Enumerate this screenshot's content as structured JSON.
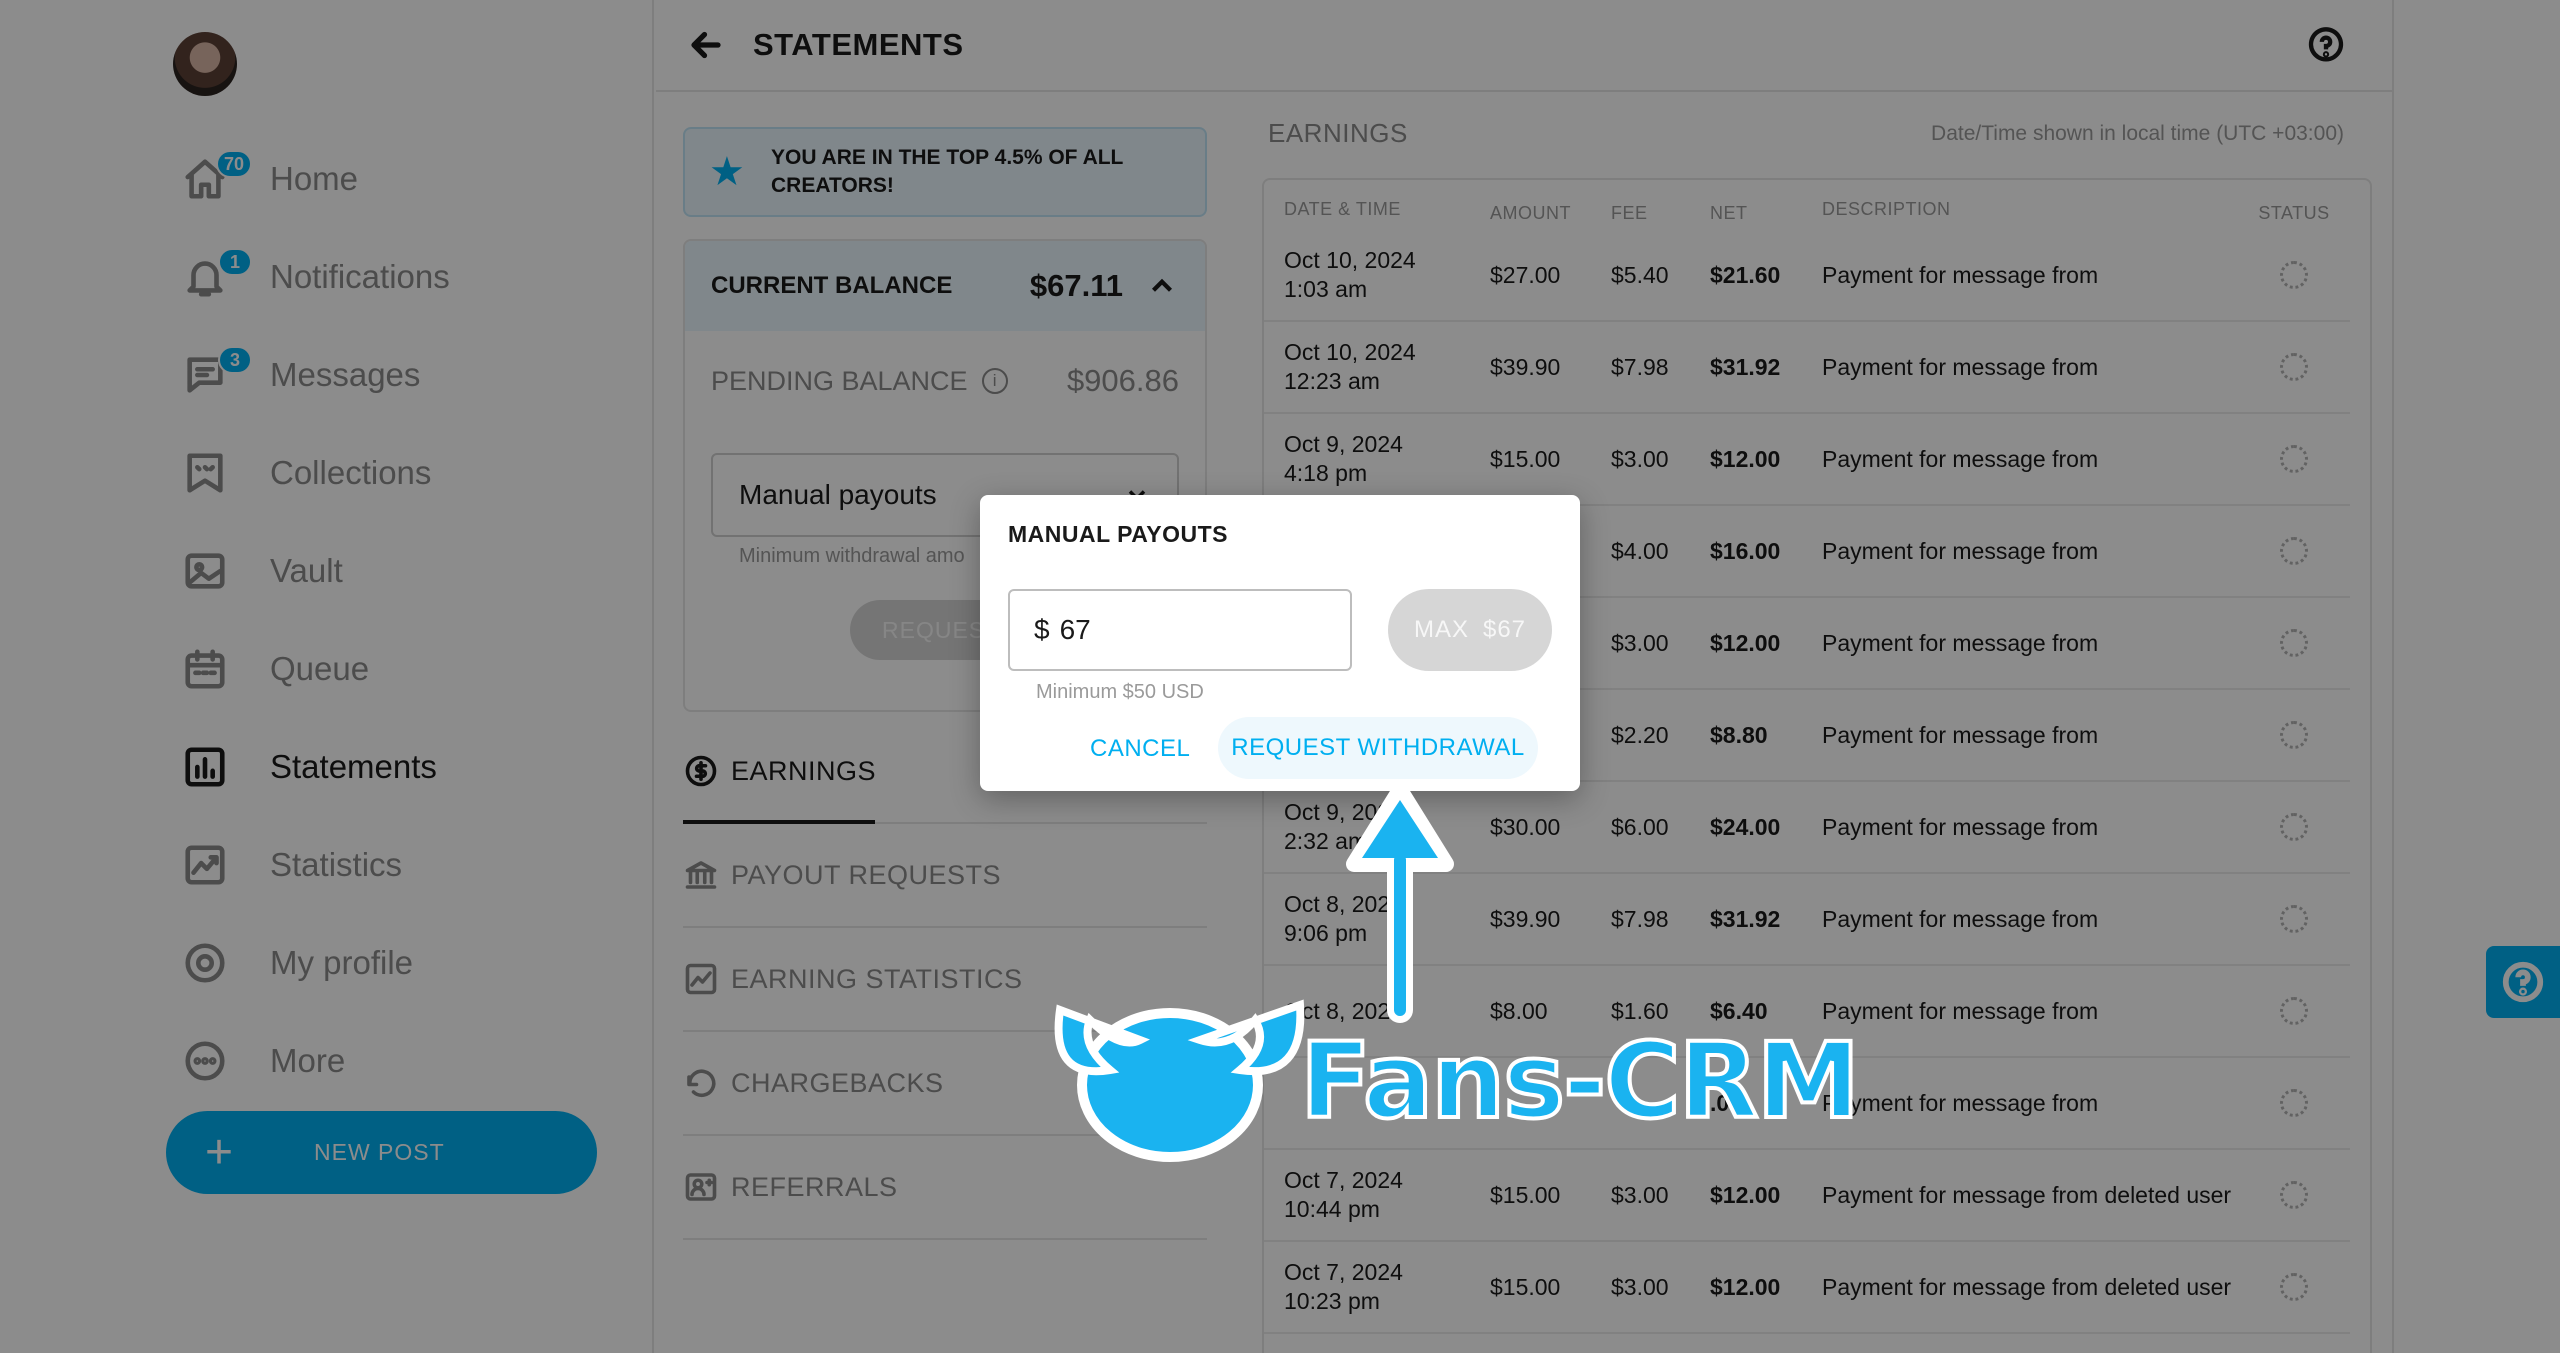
{
  "sidebar": {
    "items": [
      {
        "label": "Home",
        "badge": "70"
      },
      {
        "label": "Notifications",
        "badge": "1"
      },
      {
        "label": "Messages",
        "badge": "3"
      },
      {
        "label": "Collections",
        "badge": ""
      },
      {
        "label": "Vault",
        "badge": ""
      },
      {
        "label": "Queue",
        "badge": ""
      },
      {
        "label": "Statements",
        "badge": ""
      },
      {
        "label": "Statistics",
        "badge": ""
      },
      {
        "label": "My profile",
        "badge": ""
      },
      {
        "label": "More",
        "badge": ""
      }
    ],
    "new_post_label": "NEW POST"
  },
  "header": {
    "title": "STATEMENTS"
  },
  "banner": {
    "text": "YOU ARE IN THE TOP 4.5% OF ALL CREATORS!"
  },
  "balance": {
    "current_label": "CURRENT BALANCE",
    "current_value": "$67.11",
    "pending_label": "PENDING BALANCE",
    "pending_value": "$906.86",
    "payout_mode": "Manual payouts",
    "min_note": "Minimum withdrawal amo",
    "request_label": "REQUEST"
  },
  "tabs": [
    {
      "label": "EARNINGS"
    },
    {
      "label": "PAYOUT REQUESTS"
    },
    {
      "label": "EARNING STATISTICS"
    },
    {
      "label": "CHARGEBACKS"
    },
    {
      "label": "REFERRALS"
    }
  ],
  "earnings": {
    "title": "EARNINGS",
    "timezone_note": "Date/Time shown in local time (UTC +03:00)",
    "columns": {
      "date": "DATE & TIME",
      "amount": "AMOUNT",
      "fee": "FEE",
      "net": "NET",
      "description": "DESCRIPTION",
      "status": "STATUS"
    },
    "rows": [
      {
        "date": "Oct 10, 2024",
        "time": "1:03 am",
        "amount": "$27.00",
        "fee": "$5.40",
        "net": "$21.60",
        "description": "Payment for message from"
      },
      {
        "date": "Oct 10, 2024",
        "time": "12:23 am",
        "amount": "$39.90",
        "fee": "$7.98",
        "net": "$31.92",
        "description": "Payment for message from"
      },
      {
        "date": "Oct 9, 2024",
        "time": "4:18 pm",
        "amount": "$15.00",
        "fee": "$3.00",
        "net": "$12.00",
        "description": "Payment for message from"
      },
      {
        "date": "",
        "time": "",
        "amount": "",
        "fee": "$4.00",
        "net": "$16.00",
        "description": "Payment for message from"
      },
      {
        "date": "",
        "time": "",
        "amount": "",
        "fee": "$3.00",
        "net": "$12.00",
        "description": "Payment for message from"
      },
      {
        "date": "",
        "time": "",
        "amount": "",
        "fee": "$2.20",
        "net": "$8.80",
        "description": "Payment for message from"
      },
      {
        "date": "Oct 9, 202",
        "time": "2:32 am",
        "amount": "$30.00",
        "fee": "$6.00",
        "net": "$24.00",
        "description": "Payment for message from"
      },
      {
        "date": "Oct 8, 202",
        "time": "9:06 pm",
        "amount": "$39.90",
        "fee": "$7.98",
        "net": "$31.92",
        "description": "Payment for message from"
      },
      {
        "date": "Oct 8, 202",
        "time": "",
        "amount": "$8.00",
        "fee": "$1.60",
        "net": "$6.40",
        "description": "Payment for message from"
      },
      {
        "date": "",
        "time": "",
        "amount": "",
        "fee": "",
        "net": ".04",
        "description": "Payment for message from"
      },
      {
        "date": "Oct 7, 2024",
        "time": "10:44 pm",
        "amount": "$15.00",
        "fee": "$3.00",
        "net": "$12.00",
        "description": "Payment for message from deleted user"
      },
      {
        "date": "Oct 7, 2024",
        "time": "10:23 pm",
        "amount": "$15.00",
        "fee": "$3.00",
        "net": "$12.00",
        "description": "Payment for message from deleted user"
      }
    ]
  },
  "modal": {
    "title": "MANUAL PAYOUTS",
    "currency": "$",
    "amount_value": "67",
    "max_label": "MAX",
    "max_value": "$67",
    "min_hint": "Minimum $50 USD",
    "cancel_label": "CANCEL",
    "withdraw_label": "REQUEST WITHDRAWAL"
  },
  "watermark": {
    "text": "Fans-CRM"
  },
  "colors": {
    "accent": "#00aff0",
    "banner_bg": "#e9f6fd"
  }
}
